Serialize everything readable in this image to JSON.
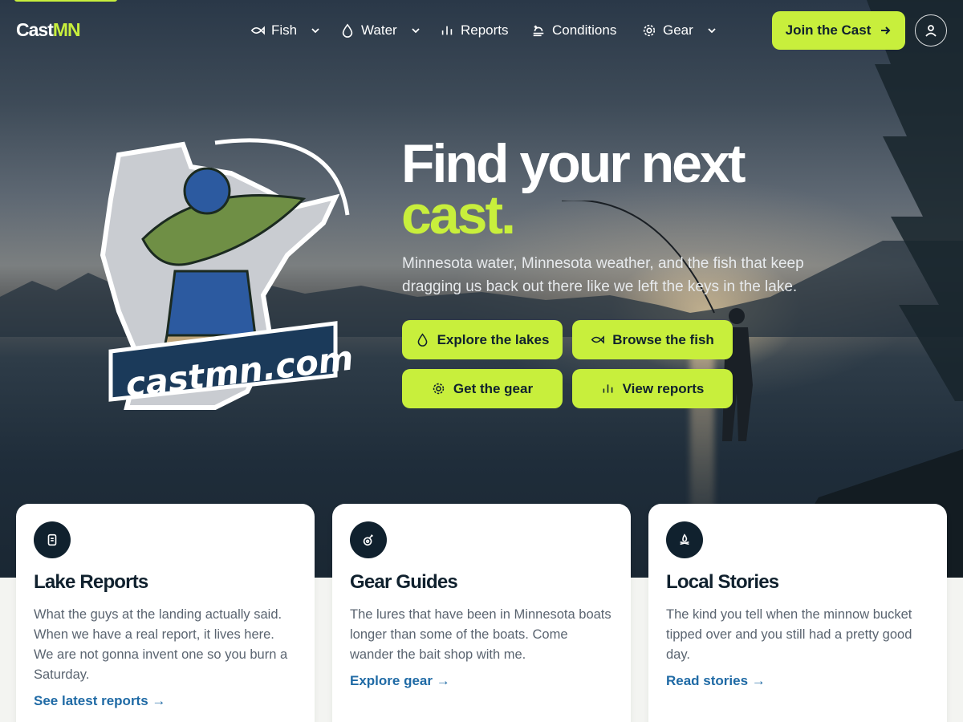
{
  "header": {
    "logo": {
      "cast": "Cast",
      "mn": "MN"
    },
    "nav": [
      {
        "label": "Fish",
        "icon": "fish-icon",
        "dropdown": true
      },
      {
        "label": "Water",
        "icon": "water-drop-icon",
        "dropdown": true
      },
      {
        "label": "Reports",
        "icon": "bar-chart-icon",
        "dropdown": false
      },
      {
        "label": "Conditions",
        "icon": "weather-icon",
        "dropdown": false
      },
      {
        "label": "Gear",
        "icon": "gear-icon",
        "dropdown": true
      }
    ],
    "join_label": "Join the Cast",
    "user_icon": "user-icon"
  },
  "hero": {
    "brand_art_text": "castmn.com",
    "headline_line1": "Find your next",
    "headline_accent": "cast.",
    "lede": "Minnesota water, Minnesota weather, and the fish that keep dragging us back out there like we left the keys in the lake.",
    "buttons": [
      {
        "label": "Explore the lakes",
        "icon": "water-drop-icon"
      },
      {
        "label": "Browse the fish",
        "icon": "fish-icon"
      },
      {
        "label": "Get the gear",
        "icon": "gear-icon"
      },
      {
        "label": "View reports",
        "icon": "bar-chart-icon"
      }
    ]
  },
  "cards": [
    {
      "icon": "report-icon",
      "title": "Lake Reports",
      "body": "What the guys at the landing actually said. When we have a real report, it lives here. We are not gonna invent one so you burn a Saturday.",
      "link": "See latest reports →"
    },
    {
      "icon": "reel-icon",
      "title": "Gear Guides",
      "body": "The lures that have been in Minnesota boats longer than some of the boats. Come wander the bait shop with me.",
      "link": "Explore gear →"
    },
    {
      "icon": "campfire-icon",
      "title": "Local Stories",
      "body": "The kind you tell when the minnow bucket tipped over and you still had a pretty good day.",
      "link": "Read stories →"
    }
  ],
  "colors": {
    "accent": "#c8ef3c",
    "navy": "#10212e",
    "link": "#1f6aa5"
  }
}
